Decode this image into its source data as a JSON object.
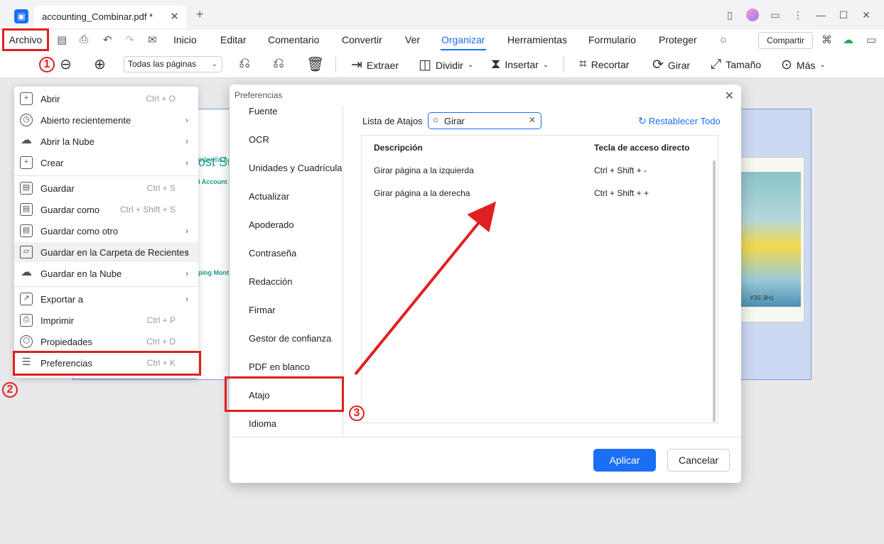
{
  "titlebar": {
    "tab_title": "accounting_Combinar.pdf *",
    "tab_close": "✕",
    "new_tab": "+"
  },
  "menubar": {
    "archivo": "Archivo",
    "items": [
      "Inicio",
      "Editar",
      "Comentario",
      "Convertir",
      "Ver",
      "Organizar",
      "Herramientas",
      "Formulario",
      "Proteger"
    ],
    "active": "Organizar",
    "share": "Compartir"
  },
  "toolbar": {
    "page_select": "Todas las páginas",
    "extract": "Extraer",
    "split": "Dividir",
    "insert": "Insertar",
    "crop": "Recortar",
    "rotate": "Girar",
    "size": "Tamaño",
    "more": "Más"
  },
  "markers": {
    "m1": "1",
    "m2": "2",
    "m3": "3"
  },
  "page_preview": {
    "line1": "mbrella Acc",
    "line2": "ost Su",
    "line3": "l Account",
    "line4": "ping Month",
    "image_caption": "THE SEA"
  },
  "file_menu": {
    "items": [
      {
        "label": "Abrir",
        "shortcut": "Ctrl + O",
        "icon": "plus-icon"
      },
      {
        "label": "Abierto recientemente",
        "shortcut": "",
        "icon": "clock-icon",
        "submenu": true
      },
      {
        "label": "Abrir la Nube",
        "shortcut": "",
        "icon": "cloud-icon",
        "submenu": true
      },
      {
        "label": "Crear",
        "shortcut": "",
        "icon": "create-icon",
        "submenu": true
      },
      {
        "label": "Guardar",
        "shortcut": "Ctrl + S",
        "icon": "save-icon"
      },
      {
        "label": "Guardar como",
        "shortcut": "Ctrl + Shift + S",
        "icon": "save-as-icon"
      },
      {
        "label": "Guardar como otro",
        "shortcut": "",
        "icon": "save-other-icon",
        "submenu": true
      },
      {
        "label": "Guardar en la Carpeta de Recientes",
        "shortcut": "",
        "icon": "folder-icon",
        "submenu": true
      },
      {
        "label": "Guardar en la Nube",
        "shortcut": "",
        "icon": "cloud-upload-icon",
        "submenu": true
      },
      {
        "label": "Exportar a",
        "shortcut": "",
        "icon": "export-icon",
        "submenu": true
      },
      {
        "label": "Imprimir",
        "shortcut": "Ctrl + P",
        "icon": "print-icon"
      },
      {
        "label": "Propiedades",
        "shortcut": "Ctrl + D",
        "icon": "properties-icon"
      },
      {
        "label": "Preferencias",
        "shortcut": "Ctrl + K",
        "icon": "preferences-icon"
      }
    ]
  },
  "dialog": {
    "title": "Preferencias",
    "sidebar": [
      "Fuente",
      "OCR",
      "Unidades y Cuadrícula",
      "Actualizar",
      "Apoderado",
      "Contraseña",
      "Redacción",
      "Firmar",
      "Gestor de confianza",
      "PDF en blanco",
      "Atajo",
      "Idioma"
    ],
    "shortcut_list_label": "Lista de Atajos",
    "search_value": "Girar",
    "reset_all": "Restablecer Todo",
    "table": {
      "headers": [
        "Descripción",
        "Tecla de acceso directo"
      ],
      "rows": [
        [
          "Girar página a la izquierda",
          "Ctrl + Shift + -"
        ],
        [
          "Girar página a la derecha",
          "Ctrl + Shift + +"
        ]
      ]
    },
    "apply": "Aplicar",
    "cancel": "Cancelar"
  },
  "colors": {
    "accent": "#1a6ff5",
    "annotation_red": "#e02020"
  }
}
